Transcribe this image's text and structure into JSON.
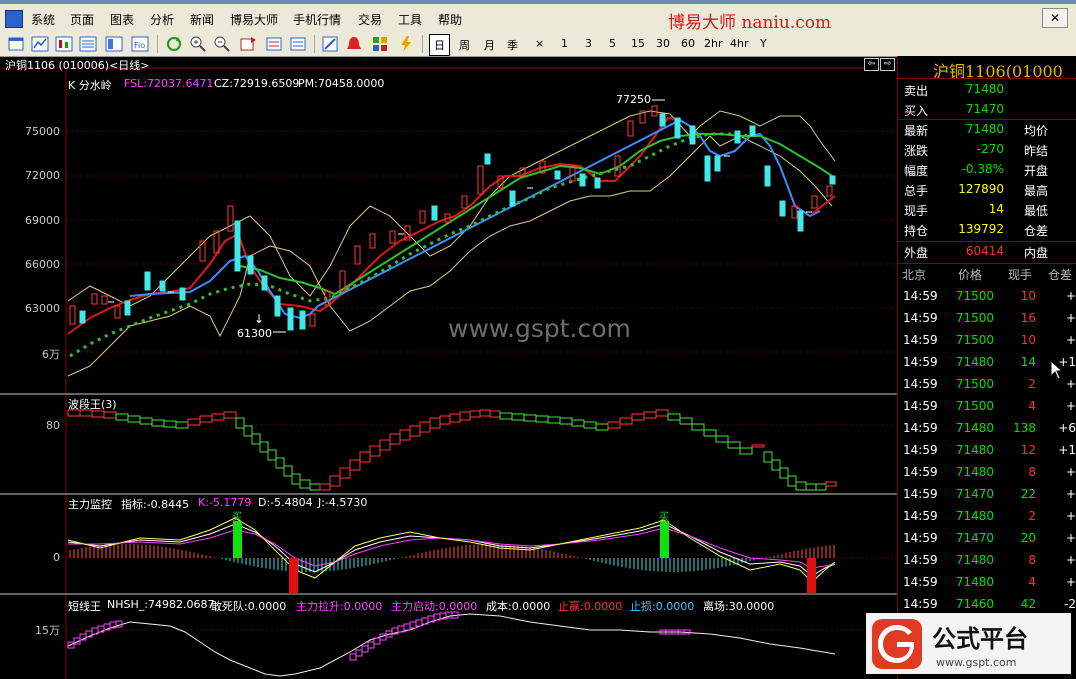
{
  "app": {
    "brand": "博易大师  naniu.com",
    "close_label": "✕"
  },
  "menu": [
    "系统",
    "页面",
    "图表",
    "分析",
    "新闻",
    "博易大师",
    "手机行情",
    "交易",
    "工具",
    "帮助"
  ],
  "toolbar": {
    "icons": [
      "open-icon",
      "line-chart-icon",
      "kline-icon",
      "report-icon",
      "list-icon",
      "f10-icon",
      "refresh-icon",
      "zoom-in-icon",
      "zoom-out-icon",
      "restore-icon",
      "window-icon",
      "draw-icon",
      "alarm-icon",
      "formula-icon",
      "lightning-icon"
    ],
    "periods": [
      "日",
      "周",
      "月",
      "季",
      "×",
      "1",
      "3",
      "5",
      "15",
      "30",
      "60",
      "2hr",
      "4hr",
      "Y"
    ],
    "active_period": "日"
  },
  "chart": {
    "window_title": "沪铜1106 (010006)<日线>",
    "nav": [
      "⇦",
      "⇨"
    ],
    "main_panel": {
      "name": "K  分水岭",
      "fsl_label": "FSL:72037.6471",
      "cz_label": "CZ:72919.6509",
      "pm_label": "PM:70458.0000",
      "y_labels": [
        "75000",
        "72000",
        "69000",
        "66000",
        "63000",
        "6万"
      ],
      "high_label": "77250",
      "low_label": "61300"
    },
    "wave_panel": {
      "name": "波段王(3)",
      "y_label": "80"
    },
    "main_force_panel": {
      "name": "主力监控",
      "index_label": "指标:-0.8445",
      "k_label": "K:-5.1779",
      "d_label": "D:-5.4804",
      "j_label": "J:-4.5730",
      "y_label": "0",
      "marker_text": "买"
    },
    "short_panel": {
      "name": "短线王",
      "items": [
        {
          "text": "NHSH_:74982.0687",
          "color": "#ffffff"
        },
        {
          "text": "敢死队:0.0000",
          "color": "#ffffff"
        },
        {
          "text": "主力拉升:0.0000",
          "color": "#ff44ff"
        },
        {
          "text": "主力启动:0.0000",
          "color": "#ff44ff"
        },
        {
          "text": "成本:0.0000",
          "color": "#ffffff"
        },
        {
          "text": "止赢:0.0000",
          "color": "#ff3030"
        },
        {
          "text": "止损:0.0000",
          "color": "#40c0ff"
        },
        {
          "text": "离场:30.0000",
          "color": "#ffffff"
        }
      ],
      "y_label": "15万"
    },
    "watermark": "www.gspt.com"
  },
  "quote": {
    "title": "沪铜1106(01000",
    "left": [
      {
        "label": "卖出",
        "value": "71480",
        "color": "#00e000"
      },
      {
        "label": "买入",
        "value": "71470",
        "color": "#00e000"
      },
      {
        "label": "最新",
        "value": "71480",
        "color": "#00e000"
      },
      {
        "label": "涨跌",
        "value": "-270",
        "color": "#00e000"
      },
      {
        "label": "幅度",
        "value": "-0.38%",
        "color": "#00e000"
      },
      {
        "label": "总手",
        "value": "127890",
        "color": "#ffff00"
      },
      {
        "label": "现手",
        "value": "14",
        "color": "#ffff00"
      },
      {
        "label": "持仓",
        "value": "139792",
        "color": "#ffff00"
      },
      {
        "label": "外盘",
        "value": "60414",
        "color": "#ff3030"
      }
    ],
    "right_labels": [
      "均价",
      "昨结",
      "开盘",
      "最高",
      "最低",
      "仓差",
      "内盘"
    ]
  },
  "ticks": {
    "headers": [
      "北京",
      "价格",
      "现手",
      "仓差"
    ],
    "rows": [
      {
        "time": "14:59",
        "price": "71500",
        "vol": "10",
        "chg": "+",
        "vol_color": "#ff3030"
      },
      {
        "time": "14:59",
        "price": "71500",
        "vol": "16",
        "chg": "+",
        "vol_color": "#ff3030"
      },
      {
        "time": "14:59",
        "price": "71500",
        "vol": "10",
        "chg": "+",
        "vol_color": "#ff3030"
      },
      {
        "time": "14:59",
        "price": "71480",
        "vol": "14",
        "chg": "+1",
        "vol_color": "#00e000"
      },
      {
        "time": "14:59",
        "price": "71500",
        "vol": "2",
        "chg": "+",
        "vol_color": "#ff3030"
      },
      {
        "time": "14:59",
        "price": "71500",
        "vol": "4",
        "chg": "+",
        "vol_color": "#ff3030"
      },
      {
        "time": "14:59",
        "price": "71480",
        "vol": "138",
        "chg": "+6",
        "vol_color": "#00e000"
      },
      {
        "time": "14:59",
        "price": "71480",
        "vol": "12",
        "chg": "+1",
        "vol_color": "#ff3030"
      },
      {
        "time": "14:59",
        "price": "71480",
        "vol": "8",
        "chg": "+",
        "vol_color": "#ff3030"
      },
      {
        "time": "14:59",
        "price": "71470",
        "vol": "22",
        "chg": "+",
        "vol_color": "#00e000"
      },
      {
        "time": "14:59",
        "price": "71480",
        "vol": "2",
        "chg": "+",
        "vol_color": "#ff3030"
      },
      {
        "time": "14:59",
        "price": "71470",
        "vol": "20",
        "chg": "+",
        "vol_color": "#00e000"
      },
      {
        "time": "14:59",
        "price": "71480",
        "vol": "8",
        "chg": "+",
        "vol_color": "#ff3030"
      },
      {
        "time": "14:59",
        "price": "71480",
        "vol": "4",
        "chg": "+",
        "vol_color": "#ff3030"
      },
      {
        "time": "14:59",
        "price": "71460",
        "vol": "42",
        "chg": "-2",
        "vol_color": "#00e000"
      }
    ]
  },
  "logo": {
    "name": "公式平台",
    "url": "www.gspt.com"
  }
}
